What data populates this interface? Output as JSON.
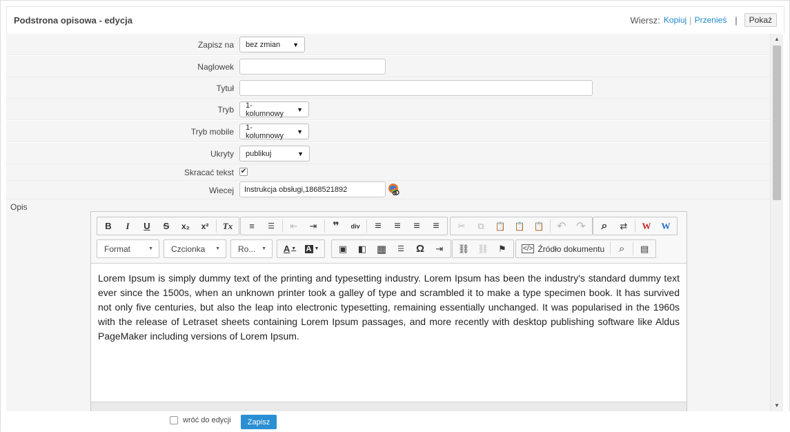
{
  "header": {
    "title": "Podstrona opisowa - edycja",
    "row_label": "Wiersz:",
    "copy_link": "Kopiuj",
    "move_link": "Przenieś",
    "pipe": "|",
    "show_button": "Pokaż"
  },
  "form": {
    "save_to": {
      "label": "Zapisz na",
      "value": "bez zmian"
    },
    "heading": {
      "label": "Naglowek",
      "value": ""
    },
    "title": {
      "label": "Tytuł",
      "value": ""
    },
    "mode": {
      "label": "Tryb",
      "value": "1-kolumnowy"
    },
    "mode_mobile": {
      "label": "Tryb mobile",
      "value": "1-kolumnowy"
    },
    "hidden": {
      "label": "Ukryty",
      "value": "publikuj"
    },
    "shorten": {
      "label": "Skracać tekst",
      "checked": true,
      "mark": "✔"
    },
    "more": {
      "label": "Wiecej",
      "value": "Instrukcja obsługi,1868521892"
    }
  },
  "opis": {
    "label": "Opis",
    "toolbar": {
      "format": "Format",
      "font": "Czcionka",
      "size": "Ro...",
      "source": "Źródło dokumentu"
    },
    "content": "Lorem Ipsum is simply dummy text of the printing and typesetting industry. Lorem Ipsum has been the industry's standard dummy text ever since the 1500s, when an unknown printer took a galley of type and scrambled it to make a type specimen book. It has survived not only five centuries, but also the leap into electronic typesetting, remaining essentially unchanged. It was popularised in the 1960s with the release of Letraset sheets containing Lorem Ipsum passages, and more recently with desktop publishing software like Aldus PageMaker including versions of Lorem Ipsum."
  },
  "footer": {
    "return_label": "wróć do edycji",
    "save_button": "Zapisz"
  },
  "icons": {
    "bold": "B",
    "italic": "I",
    "underline": "U",
    "strike": "S",
    "subscript": "x₂",
    "superscript": "x²",
    "remove_format": "Tx",
    "ordered_list": "≡",
    "bullet_list": "☰",
    "outdent": "⇤",
    "indent": "⇥",
    "blockquote": "❞",
    "div": "div",
    "align_left": "≡",
    "align_center": "≡",
    "align_right": "≡",
    "justify": "≡",
    "cut": "✂",
    "copy": "⧉",
    "paste": "📋",
    "undo": "↶",
    "redo": "↷",
    "find": "⌕",
    "replace": "⇄",
    "text_color": "A",
    "bg_color": "A",
    "image": "▣",
    "flash": "◧",
    "table": "▦",
    "hr": "☰",
    "special_char": "Ω",
    "page_break": "⇥",
    "link": "⛓",
    "unlink": "⛓",
    "anchor": "⚑",
    "preview": "⌕",
    "templates": "▤",
    "arrow_down": "▼",
    "arrow_up": "▲",
    "caret": "▾"
  },
  "colors": {
    "accent": "#2a8fd3",
    "link": "#1e88c9",
    "word_red": "#c62828",
    "word_blue": "#1e6fc9"
  }
}
